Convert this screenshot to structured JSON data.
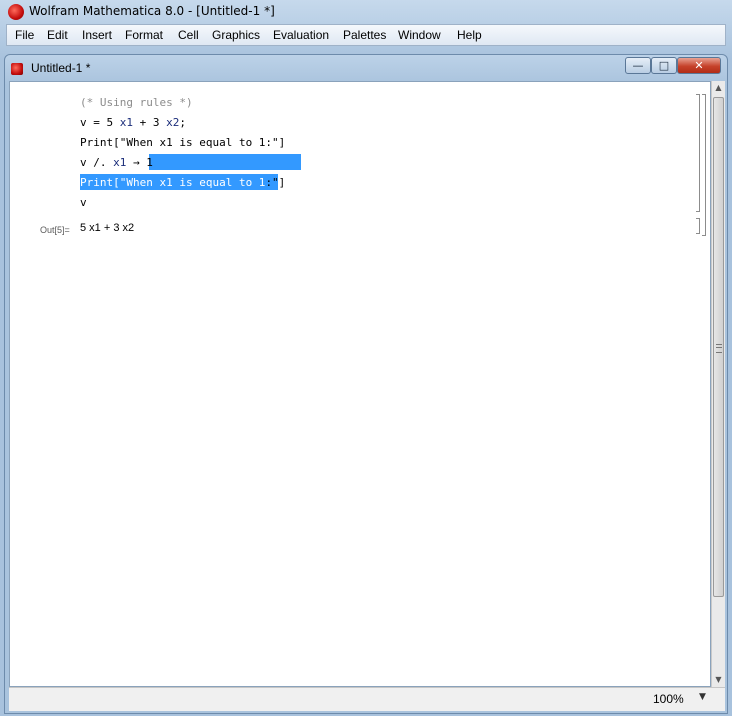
{
  "app": {
    "title": "Wolfram Mathematica 8.0 - [Untitled-1 *]"
  },
  "menu": [
    "File",
    "Edit",
    "Insert",
    "Format",
    "Cell",
    "Graphics",
    "Evaluation",
    "Palettes",
    "Window",
    "Help"
  ],
  "notebook": {
    "title": "Untitled-1 *",
    "input_lines": [
      "(* Using rules *)",
      "v = 5 x1 + 3 x2;",
      "Print[\"When x1 is equal to 1:\"]",
      "v /. x1 → 1",
      "Print[\"When x1 is equal to 1:\"]",
      "v"
    ],
    "line2": {
      "a": "v = 5 ",
      "b": "x1",
      "c": " + 3 ",
      "d": "x2",
      "e": ";"
    },
    "line4": {
      "a": "v /. ",
      "b": "x1",
      "c": " → 1"
    },
    "line5": {
      "sel": "Print[\"When x1 is equal to 1",
      "rest": ":\"]"
    },
    "output_label": "Out[5]=",
    "output_expr": "5 x1 + 3 x2"
  },
  "statusbar": {
    "zoom": "100%"
  },
  "window_buttons": {
    "minimize": "—",
    "maximize": "□",
    "close": "✕"
  },
  "icons": [
    "mathematica-icon",
    "minimize-icon",
    "maximize-icon",
    "close-icon",
    "scroll-up-icon",
    "scroll-down-icon",
    "chevron-down-icon"
  ],
  "colors": {
    "selection": "#3399ff",
    "comment": "#8c8c8c"
  }
}
